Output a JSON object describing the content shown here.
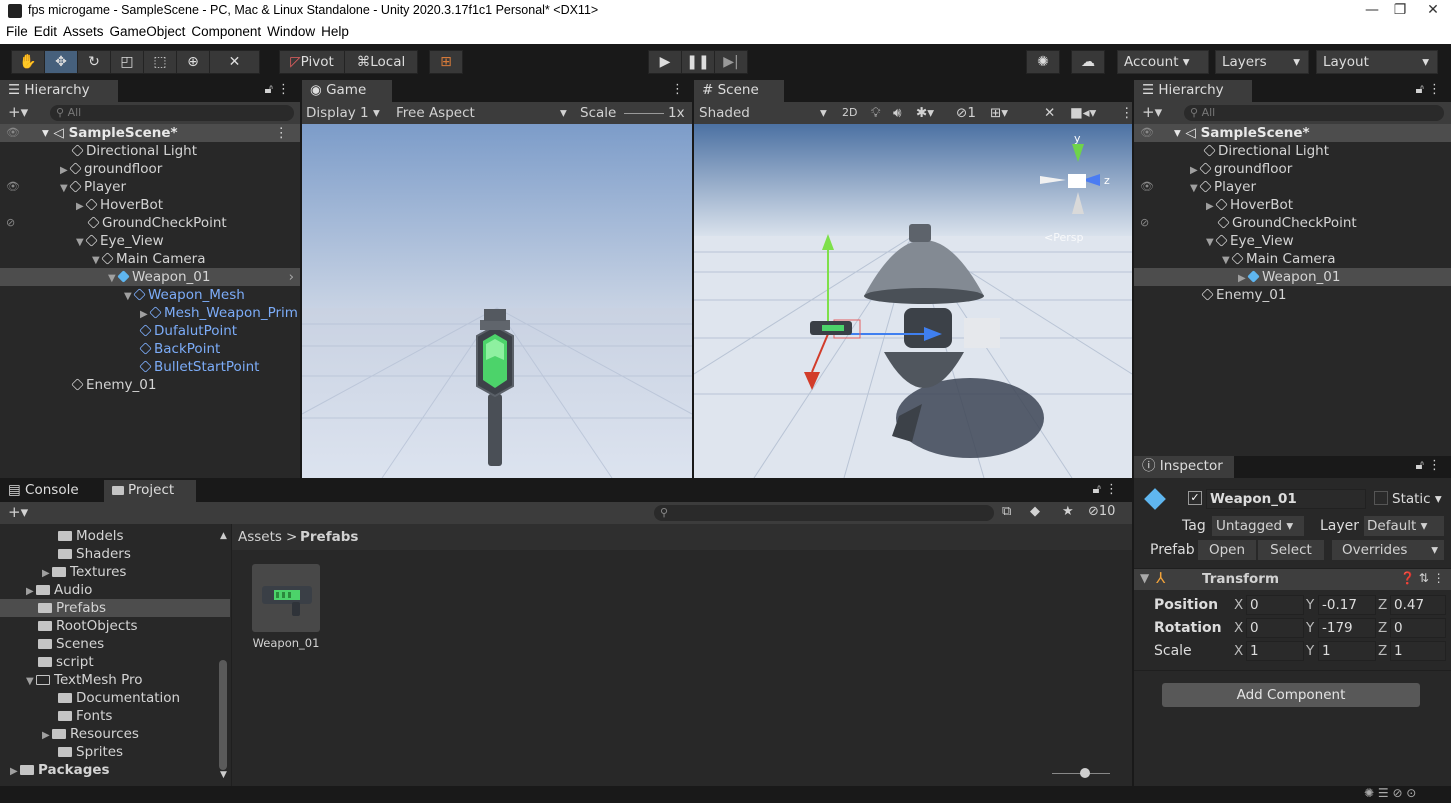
{
  "title": "fps microgame - SampleScene - PC, Mac & Linux Standalone - Unity 2020.3.17f1c1 Personal* <DX11>",
  "menu": [
    "File",
    "Edit",
    "Assets",
    "GameObject",
    "Component",
    "Window",
    "Help"
  ],
  "toolbar": {
    "pivot": "Pivot",
    "local": "Local",
    "account": "Account",
    "layers": "Layers",
    "layout": "Layout"
  },
  "hierarchy": {
    "tab": "Hierarchy",
    "search_placeholder": "All",
    "scene": "SampleScene*",
    "items": [
      "Directional Light",
      "groundfloor",
      "Player",
      "HoverBot",
      "GroundCheckPoint",
      "Eye_View",
      "Main Camera",
      "Weapon_01",
      "Weapon_Mesh",
      "Mesh_Weapon_Prim",
      "DufalutPoint",
      "BackPoint",
      "BulletStartPoint",
      "Enemy_01"
    ]
  },
  "game": {
    "tab": "Game",
    "display": "Display 1",
    "aspect": "Free Aspect",
    "scale_label": "Scale",
    "scale_value": "1x"
  },
  "scene": {
    "tab": "Scene",
    "shading": "Shaded",
    "mode2d": "2D",
    "hidden_count": "1",
    "persp_label": "<Persp"
  },
  "hierarchy2": {
    "tab": "Hierarchy",
    "search_placeholder": "All",
    "scene": "SampleScene*",
    "items": [
      "Directional Light",
      "groundfloor",
      "Player",
      "HoverBot",
      "GroundCheckPoint",
      "Eye_View",
      "Main Camera",
      "Weapon_01",
      "Enemy_01"
    ]
  },
  "inspector": {
    "tab": "Inspector",
    "object_name": "Weapon_01",
    "static_label": "Static",
    "tag_label": "Tag",
    "tag_value": "Untagged",
    "layer_label": "Layer",
    "layer_value": "Default",
    "prefab_label": "Prefab",
    "open": "Open",
    "select": "Select",
    "overrides": "Overrides",
    "transform": "Transform",
    "position_label": "Position",
    "rotation_label": "Rotation",
    "scale_label": "Scale",
    "px": "0",
    "py": "-0.17",
    "pz": "0.47",
    "rx": "0",
    "ry": "-179",
    "rz": "0",
    "sx": "1",
    "sy": "1",
    "sz": "1",
    "add_component": "Add Component"
  },
  "console_tab": "Console",
  "project": {
    "tab": "Project",
    "hidden_count": "10",
    "tree": [
      "Models",
      "Shaders",
      "Textures",
      "Audio",
      "Prefabs",
      "RootObjects",
      "Scenes",
      "script",
      "TextMesh Pro",
      "Documentation",
      "Fonts",
      "Resources",
      "Sprites",
      "Packages"
    ],
    "breadcrumb_root": "Assets",
    "breadcrumb_leaf": "Prefabs",
    "asset_name": "Weapon_01"
  }
}
